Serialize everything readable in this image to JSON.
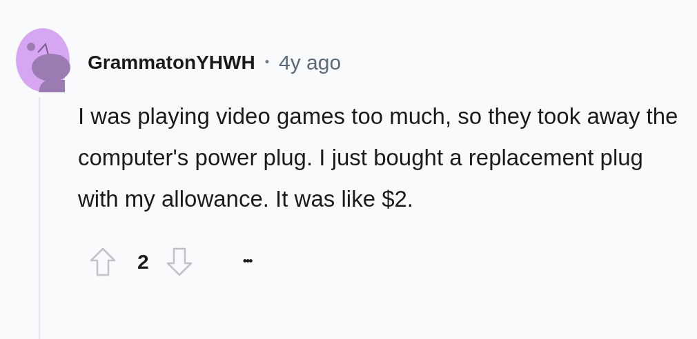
{
  "comment": {
    "author": "GrammatonYHWH",
    "separator": "•",
    "time": "4y ago",
    "body": "I was playing video games too much, so they took away the computer's power plug. I just bought a replacement plug with my allowance. It was like $2.",
    "votes": {
      "score": "2"
    },
    "more": "•••"
  }
}
